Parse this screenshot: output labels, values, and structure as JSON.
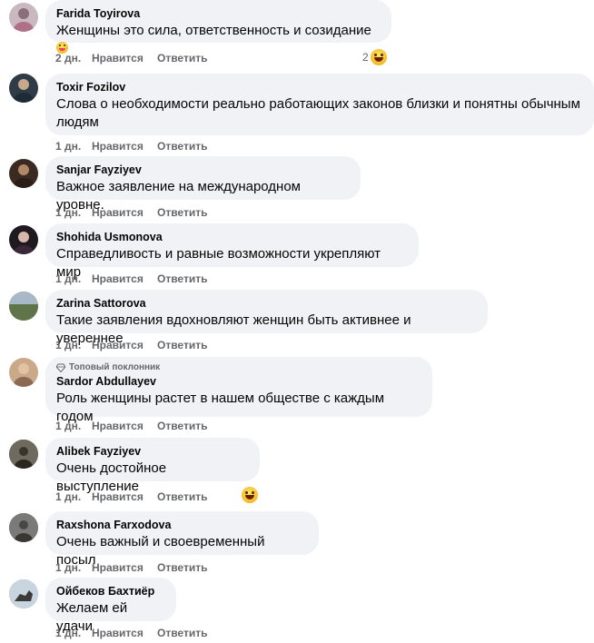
{
  "actions": {
    "like": "Нравится",
    "reply": "Ответить"
  },
  "comments": [
    {
      "author": "Farida Toyirova",
      "text": "Женщины это сила, ответственность и созидание",
      "time": "2 дн.",
      "reaction_count": "2",
      "avatar_color": "#c9b8c0"
    },
    {
      "author": "Toxir Fozilov",
      "text": "Слова о необходимости реально работающих законов близки и понятны обычным людям",
      "time": "1 дн.",
      "avatar_color": "#2f3b46"
    },
    {
      "author": "Sanjar Fayziyev",
      "text": "Важное заявление на международном уровне.",
      "time": "1 дн.",
      "avatar_color": "#3a2a22"
    },
    {
      "author": "Shohida Usmonova",
      "text": "Справедливость и равные возможности укрепляют мир",
      "time": "1 дн.",
      "avatar_color": "#1f1a1f"
    },
    {
      "author": "Zarina Sattorova",
      "text": "Такие заявления вдохновляют женщин быть активнее и увереннее",
      "time": "1 дн.",
      "avatar_color": "#7d8f6a"
    },
    {
      "badge": "Топовый поклонник",
      "author": "Sardor Abdullayev",
      "text": "Роль женщины растет в нашем обществе с каждым годом",
      "time": "1 дн.",
      "avatar_color": "#c9a98a"
    },
    {
      "author": "Alibek Fayziyev",
      "text": "Очень достойное выступление",
      "time": "1 дн.",
      "avatar_color": "#5a5548"
    },
    {
      "author": "Raxshona Farxodova",
      "text": "Очень важный и своевременный посыл",
      "time": "1 дн.",
      "avatar_color": "#6a6a6a"
    },
    {
      "author": "Ойбеков Бахтиёр",
      "text": "Желаем ей удачи",
      "time": "1 дн.",
      "avatar_color": "#8fa0b0"
    }
  ]
}
